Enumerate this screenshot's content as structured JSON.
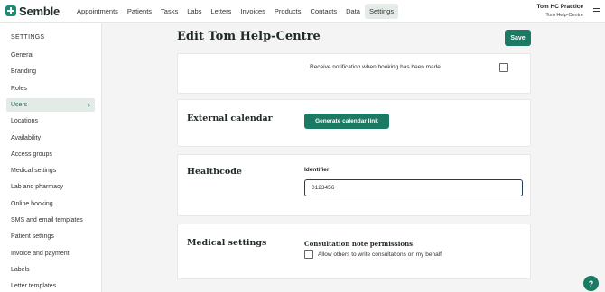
{
  "brand": {
    "name": "Semble"
  },
  "nav": {
    "items": [
      "Appointments",
      "Patients",
      "Tasks",
      "Labs",
      "Letters",
      "Invoices",
      "Products",
      "Contacts",
      "Data",
      "Settings"
    ],
    "active": "Settings"
  },
  "account": {
    "practice": "Tom HC Practice",
    "user": "Tom Help-Centre"
  },
  "sidebar": {
    "heading": "SETTINGS",
    "items": [
      {
        "label": "General"
      },
      {
        "label": "Branding"
      },
      {
        "label": "Roles"
      },
      {
        "label": "Users",
        "active": true
      },
      {
        "label": "Locations"
      },
      {
        "label": "Availability"
      },
      {
        "label": "Access groups"
      },
      {
        "label": "Medical settings"
      },
      {
        "label": "Lab and pharmacy"
      },
      {
        "label": "Online booking"
      },
      {
        "label": "SMS and email templates"
      },
      {
        "label": "Patient settings"
      },
      {
        "label": "Invoice and payment"
      },
      {
        "label": "Labels"
      },
      {
        "label": "Letter templates"
      }
    ]
  },
  "page": {
    "title": "Edit Tom Help-Centre",
    "save_label": "Save"
  },
  "notification": {
    "text": "Receive notification when booking has been made",
    "checked": false
  },
  "external_calendar": {
    "title": "External calendar",
    "button_label": "Generate calendar link"
  },
  "healthcode": {
    "title": "Healthcode",
    "field_label": "Identifier",
    "field_value": "0123456"
  },
  "medical_settings": {
    "title": "Medical settings",
    "permissions_title": "Consultation note permissions",
    "permission_text": "Allow others to write consultations on my behalf",
    "checked": false
  },
  "help": {
    "label": "?"
  },
  "colors": {
    "accent": "#1a7a63",
    "background": "#f3f4f3"
  }
}
